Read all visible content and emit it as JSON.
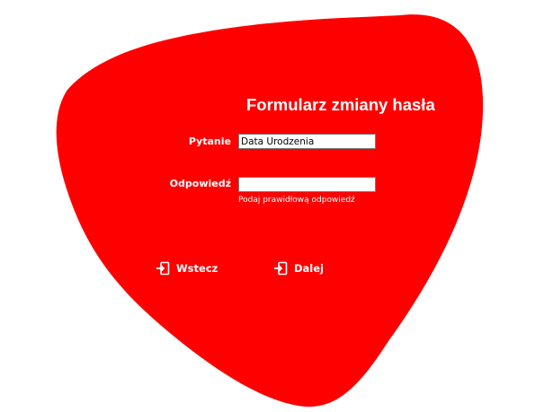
{
  "form": {
    "title": "Formularz zmiany hasła",
    "question_label": "Pytanie",
    "question_value": "Data Urodzenia",
    "answer_label": "Odpowiedź",
    "answer_value": "",
    "answer_hint": "Podaj prawidłową odpowiedź"
  },
  "navigation": {
    "back_label": "Wstecz",
    "next_label": "Dalej"
  },
  "icons": {
    "back": "login-arrow-icon",
    "next": "login-arrow-icon"
  },
  "colors": {
    "background": "#ffffff",
    "shape": "#ff0000",
    "text": "#ffffff",
    "field_border": "#7a7a7a"
  }
}
